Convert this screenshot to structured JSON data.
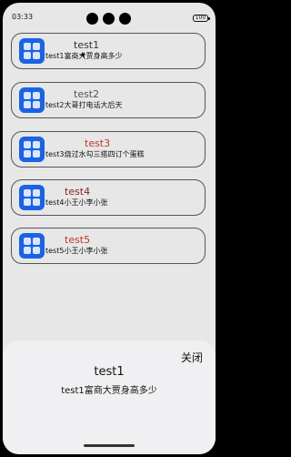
{
  "status_bar": {
    "time": "03:33",
    "battery": "100"
  },
  "items": [
    {
      "title": "test1",
      "subtitle": "test1富商大贾身高多少",
      "title_color": "#333333"
    },
    {
      "title": "test2",
      "subtitle": "test2大哥打电话大后天",
      "title_color": "#555555"
    },
    {
      "title": "test3",
      "subtitle": "test3烧过水勾三搭四订个蛋糕",
      "title_color": "#c0392b"
    },
    {
      "title": "test4",
      "subtitle": "test4小王小李小张",
      "title_color": "#8b1f1f"
    },
    {
      "title": "test5",
      "subtitle": "test5小王小李小张",
      "title_color": "#c0392b"
    }
  ],
  "sheet": {
    "close_label": "关闭",
    "title": "test1",
    "subtitle": "test1富商大贾身高多少"
  },
  "icons": {
    "app": "app-grid-icon"
  }
}
